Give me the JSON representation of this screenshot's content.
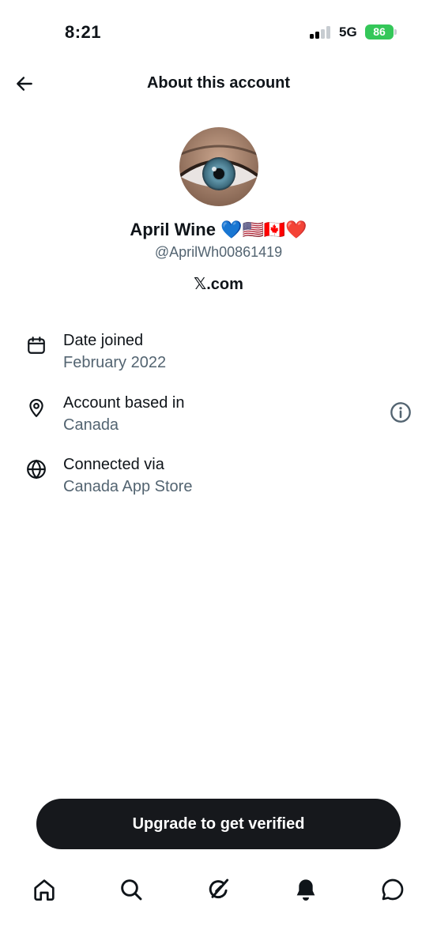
{
  "status_bar": {
    "time": "8:21",
    "network": "5G",
    "battery_level": "86",
    "battery_color": "#34c759"
  },
  "header": {
    "title": "About this account",
    "back_icon": "arrow-left-icon"
  },
  "profile": {
    "display_name": "April Wine 💙🇺🇸🇨🇦❤️",
    "handle": "@AprilWh00861419",
    "source": "𝕏.com"
  },
  "info": [
    {
      "icon": "calendar-icon",
      "label": "Date joined",
      "value": "February 2022"
    },
    {
      "icon": "location-pin-icon",
      "label": "Account based in",
      "value": "Canada"
    },
    {
      "icon": "globe-icon",
      "label": "Connected via",
      "value": "Canada App Store"
    }
  ],
  "upgrade_button": {
    "label": "Upgrade to get verified"
  },
  "bottom_nav": [
    {
      "icon": "home-icon"
    },
    {
      "icon": "search-icon"
    },
    {
      "icon": "grok-icon"
    },
    {
      "icon": "bell-icon"
    },
    {
      "icon": "messages-icon"
    }
  ],
  "colors": {
    "text_primary": "#0f1419",
    "text_secondary": "#536471",
    "button_bg": "#16181c"
  }
}
